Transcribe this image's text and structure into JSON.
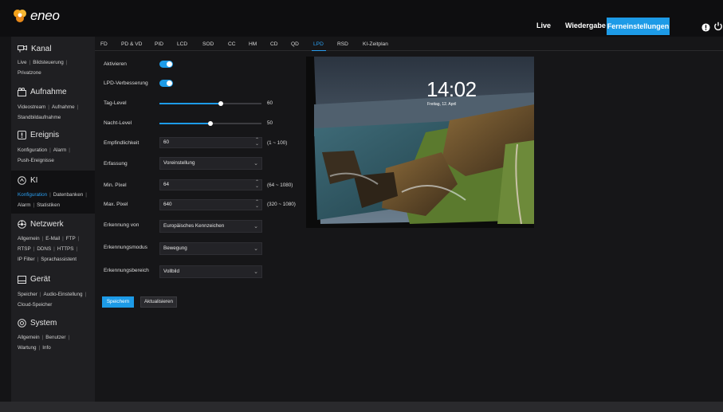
{
  "brand": {
    "name": "eneo",
    "accent": "#1d9be7"
  },
  "topnav": {
    "live": "Live",
    "playback": "Wiedergabe",
    "remote": "Ferneinstellungen"
  },
  "sidebar": {
    "sections": [
      {
        "title": "Kanal",
        "icon": "camera-icon",
        "links": [
          "Live",
          "Bildsteuerung",
          "Privatzone"
        ]
      },
      {
        "title": "Aufnahme",
        "icon": "recording-icon",
        "links": [
          "Videostream",
          "Aufnahme",
          "Standbildaufnahme"
        ]
      },
      {
        "title": "Ereignis",
        "icon": "event-icon",
        "links": [
          "Konfiguration",
          "Alarm",
          "Push-Ereignisse"
        ]
      },
      {
        "title": "KI",
        "icon": "ai-icon",
        "links": [
          "Konfiguration",
          "Datenbanken",
          "Alarm",
          "Statistiken"
        ],
        "active_link": "Konfiguration"
      },
      {
        "title": "Netzwerk",
        "icon": "network-icon",
        "links": [
          "Allgemein",
          "E-Mail",
          "FTP",
          "RTSP",
          "DDNS",
          "HTTPS",
          "IP Filter",
          "Sprachassistent"
        ]
      },
      {
        "title": "Gerät",
        "icon": "device-icon",
        "links": [
          "Speicher",
          "Audio-Einstellung",
          "Cloud-Speicher"
        ]
      },
      {
        "title": "System",
        "icon": "system-icon",
        "links": [
          "Allgemein",
          "Benutzer",
          "Wartung",
          "Info"
        ]
      }
    ]
  },
  "tabs": [
    "FD",
    "PD & VD",
    "PID",
    "LCD",
    "SOD",
    "CC",
    "HM",
    "CD",
    "QD",
    "LPD",
    "RSD",
    "KI-Zeitplan"
  ],
  "active_tab": "LPD",
  "form": {
    "enable_label": "Aktivieren",
    "enable_on": true,
    "enhance_label": "LPD-Verbesserung",
    "enhance_on": true,
    "day_level_label": "Tag-Level",
    "day_level_value": "60",
    "day_level_fraction": 0.6,
    "night_level_label": "Nacht-Level",
    "night_level_value": "50",
    "night_level_fraction": 0.5,
    "sensitivity_label": "Empfindlichkeit",
    "sensitivity_value": "60",
    "sensitivity_range": "(1 ~ 100)",
    "capture_label": "Erfassung",
    "capture_value": "Voreinstellung",
    "min_pixel_label": "Min. Pixel",
    "min_pixel_value": "64",
    "min_pixel_range": "(64 ~ 1080)",
    "max_pixel_label": "Max. Pixel",
    "max_pixel_value": "640",
    "max_pixel_range": "(320 ~ 1080)",
    "recognize_label": "Erkennung von",
    "recognize_value": "Europäisches Kennzeichen",
    "mode_label": "Erkennungsmodus",
    "mode_value": "Bewegung",
    "area_label": "Erkennungsbereich",
    "area_value": "Vollbild"
  },
  "buttons": {
    "save": "Speichern",
    "refresh": "Aktualisieren"
  },
  "preview": {
    "time": "14:02",
    "date": "Freitag, 12. April"
  }
}
